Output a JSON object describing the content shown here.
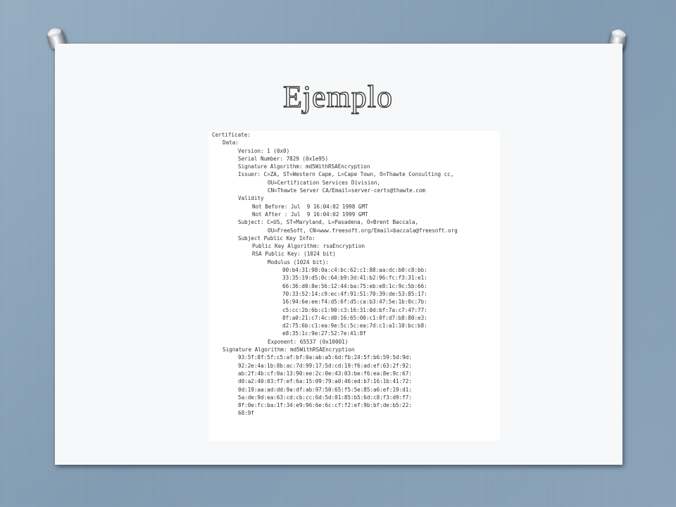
{
  "slide": {
    "title": "Ejemplo"
  },
  "certificate": {
    "lines": [
      {
        "indent": 0,
        "text": "Certificate:"
      },
      {
        "indent": 1,
        "text": "Data:"
      },
      {
        "indent": 2,
        "text": "Version: 1 (0x0)"
      },
      {
        "indent": 2,
        "text": "Serial Number: 7829 (0x1e95)"
      },
      {
        "indent": 2,
        "text": "Signature Algorithm: md5WithRSAEncryption"
      },
      {
        "indent": 2,
        "text": "Issuer: C=ZA, ST=Western Cape, L=Cape Town, O=Thawte Consulting cc,"
      },
      {
        "indent": 6,
        "text": "OU=Certification Services Division,"
      },
      {
        "indent": 6,
        "text": "CN=Thawte Server CA/Email=server-certs@thawte.com"
      },
      {
        "indent": 2,
        "text": "Validity"
      },
      {
        "indent": 3,
        "text": "Not Before: Jul  9 16:04:02 1998 GMT"
      },
      {
        "indent": 3,
        "text": "Not After : Jul  9 16:04:02 1999 GMT"
      },
      {
        "indent": 2,
        "text": "Subject: C=US, ST=Maryland, L=Pasadena, O=Brent Baccala,"
      },
      {
        "indent": 6,
        "text": "OU=FreeSoft, CN=www.freesoft.org/Email=baccala@freesoft.org"
      },
      {
        "indent": 2,
        "text": "Subject Public Key Info:"
      },
      {
        "indent": 3,
        "text": "Public Key Algorithm: rsaEncryption"
      },
      {
        "indent": 3,
        "text": "RSA Public Key: (1024 bit)"
      },
      {
        "indent": 4,
        "text": "Modulus (1024 bit):"
      },
      {
        "indent": 5,
        "text": "00:b4:31:98:0a:c4:bc:62:c1:88:aa:dc:b0:c8:bb:"
      },
      {
        "indent": 5,
        "text": "33:35:19:d5:0c:64:b9:3d:41:b2:96:fc:f3:31:e1:"
      },
      {
        "indent": 5,
        "text": "66:36:d0:8e:56:12:44:ba:75:eb:e8:1c:9c:5b:66:"
      },
      {
        "indent": 5,
        "text": "70:33:52:14:c9:ec:4f:91:51:70:39:de:53:85:17:"
      },
      {
        "indent": 5,
        "text": "16:94:6e:ee:f4:d5:6f:d5:ca:b3:47:5e:1b:0c:7b:"
      },
      {
        "indent": 5,
        "text": "c5:cc:2b:6b:c1:90:c3:16:31:0d:bf:7a:c7:47:77:"
      },
      {
        "indent": 5,
        "text": "8f:a0:21:c7:4c:d0:16:65:00:c1:0f:d7:b8:80:e3:"
      },
      {
        "indent": 5,
        "text": "d2:75:6b:c1:ea:9e:5c:5c:ea:7d:c1:a1:10:bc:b8:"
      },
      {
        "indent": 5,
        "text": "e8:35:1c:9e:27:52:7e:41:8f"
      },
      {
        "indent": 4,
        "text": "Exponent: 65537 (0x10001)"
      },
      {
        "indent": 1,
        "text": "Signature Algorithm: md5WithRSAEncryption"
      },
      {
        "indent": 2,
        "text": "93:5f:8f:5f:c5:af:bf:0a:ab:a5:6d:fb:24:5f:b6:59:5d:9d:"
      },
      {
        "indent": 2,
        "text": "92:2e:4a:1b:8b:ac:7d:99:17:5d:cd:19:f6:ad:ef:63:2f:92:"
      },
      {
        "indent": 2,
        "text": "ab:2f:4b:cf:0a:13:90:ee:2c:0e:43:03:be:f6:ea:8e:9c:67:"
      },
      {
        "indent": 2,
        "text": "d0:a2:40:03:f7:ef:6a:15:09:79:a0:46:ed:b7:16:1b:41:72:"
      },
      {
        "indent": 2,
        "text": "0d:19:aa:ad:dd:9a:df:ab:97:50:65:f5:5e:85:a6:ef:19:d1:"
      },
      {
        "indent": 2,
        "text": "5a:de:9d:ea:63:cd:cb:cc:6d:5d:01:85:b5:6d:c8:f3:d9:f7:"
      },
      {
        "indent": 2,
        "text": "8f:0e:fc:ba:1f:34:e9:96:6e:6c:cf:f2:ef:9b:bf:de:b5:22:"
      },
      {
        "indent": 2,
        "text": "68:9f"
      }
    ]
  }
}
